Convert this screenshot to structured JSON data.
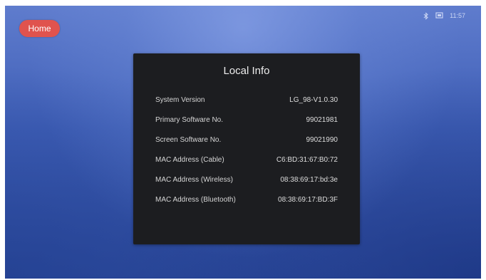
{
  "home_button": {
    "label": "Home"
  },
  "status_bar": {
    "time": "11:57",
    "icons": [
      "bluetooth-icon",
      "screen-cast-icon"
    ]
  },
  "panel": {
    "title": "Local Info",
    "rows": [
      {
        "label": "System Version",
        "value": "LG_98-V1.0.30"
      },
      {
        "label": "Primary Software No.",
        "value": "99021981"
      },
      {
        "label": "Screen Software No.",
        "value": "99021990"
      },
      {
        "label": "MAC Address (Cable)",
        "value": "C6:BD:31:67:B0:72"
      },
      {
        "label": "MAC Address (Wireless)",
        "value": "08:38:69:17:bd:3e"
      },
      {
        "label": "MAC Address (Bluetooth)",
        "value": "08:38:69:17:BD:3F"
      }
    ]
  },
  "colors": {
    "home_button": "#e0534e",
    "panel_background": "#1c1d20",
    "screen_background": "#3f5fb7"
  }
}
